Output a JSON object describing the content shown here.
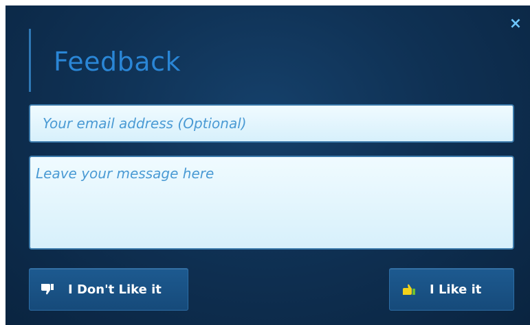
{
  "dialog": {
    "title": "Feedback",
    "close_label": "×"
  },
  "form": {
    "email_placeholder": "Your email address (Optional)",
    "message_placeholder": "Leave your message here"
  },
  "buttons": {
    "dislike_label": "I Don't Like it",
    "like_label": "I Like it"
  },
  "icons": {
    "close": "close-icon",
    "dislike": "thumbs-down-icon",
    "like": "thumbs-up-icon"
  },
  "colors": {
    "accent": "#2a86d6",
    "background": "#0f3154",
    "field": "#e4f6fd",
    "placeholder": "#4a9ad4",
    "like_icon": "#f2d21a",
    "dislike_icon": "#ffffff"
  }
}
